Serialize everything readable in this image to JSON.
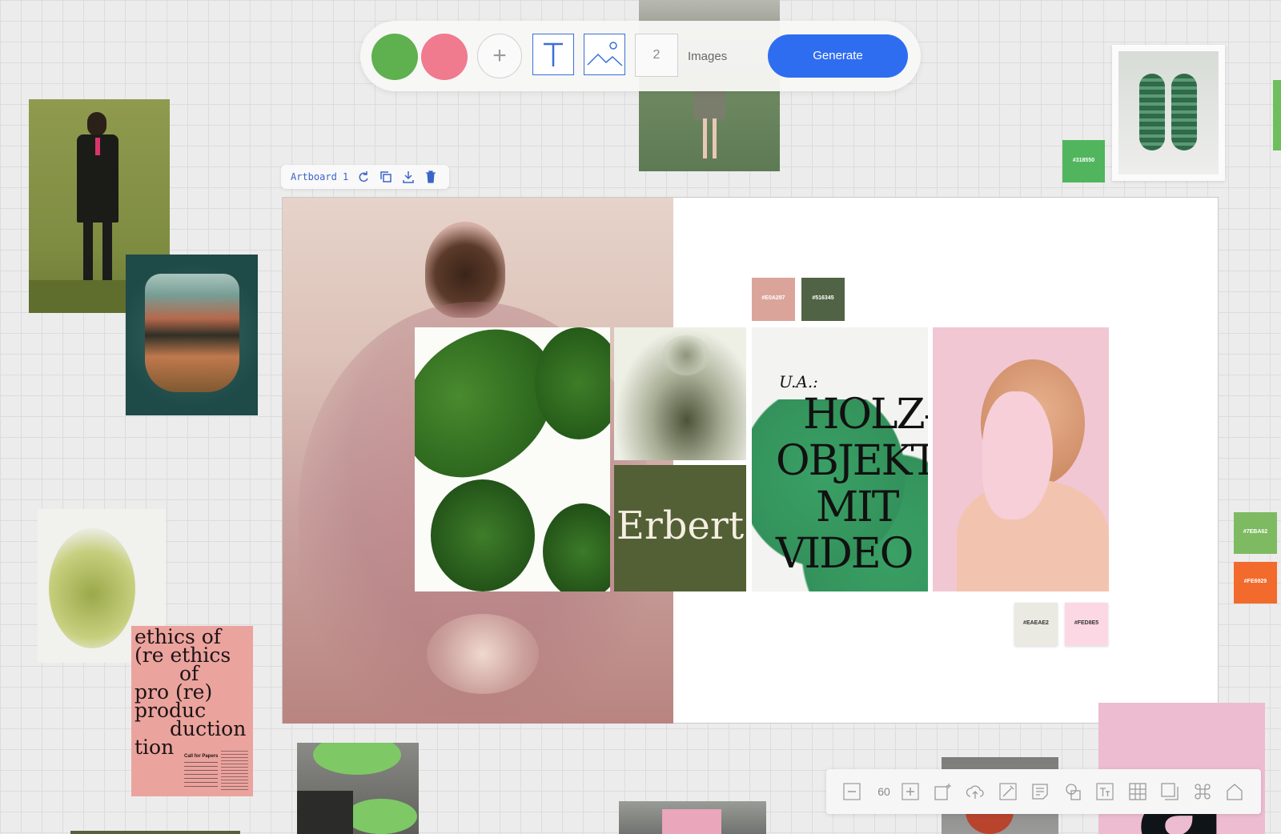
{
  "toolbar": {
    "swatches": [
      {
        "name": "green",
        "color": "#5fb04f"
      },
      {
        "name": "pink",
        "color": "#f07a8e"
      }
    ],
    "count": "2",
    "count_label": "Images",
    "generate_label": "Generate"
  },
  "artboard": {
    "label": "Artboard 1",
    "erbert_text": "Erbert",
    "poster_heading": "U.A.:",
    "poster_lines": [
      "HOLZ-",
      "OBJEKT",
      "MIT",
      "VIDEO"
    ]
  },
  "color_chips": {
    "c1": "#E0A297",
    "c2": "#516345",
    "c3": "#EAEAE2",
    "c4": "#FED8E5",
    "c5": "#318550",
    "c6": "#7EBA62",
    "c7": "#FE6929"
  },
  "ethics_poster": {
    "lines": [
      "ethics of",
      "(re ethics",
      "of",
      "pro (re)",
      "produc",
      "duction",
      "tion"
    ],
    "call": "Call for Papers"
  },
  "bottom_toolbar": {
    "zoom": "60"
  }
}
